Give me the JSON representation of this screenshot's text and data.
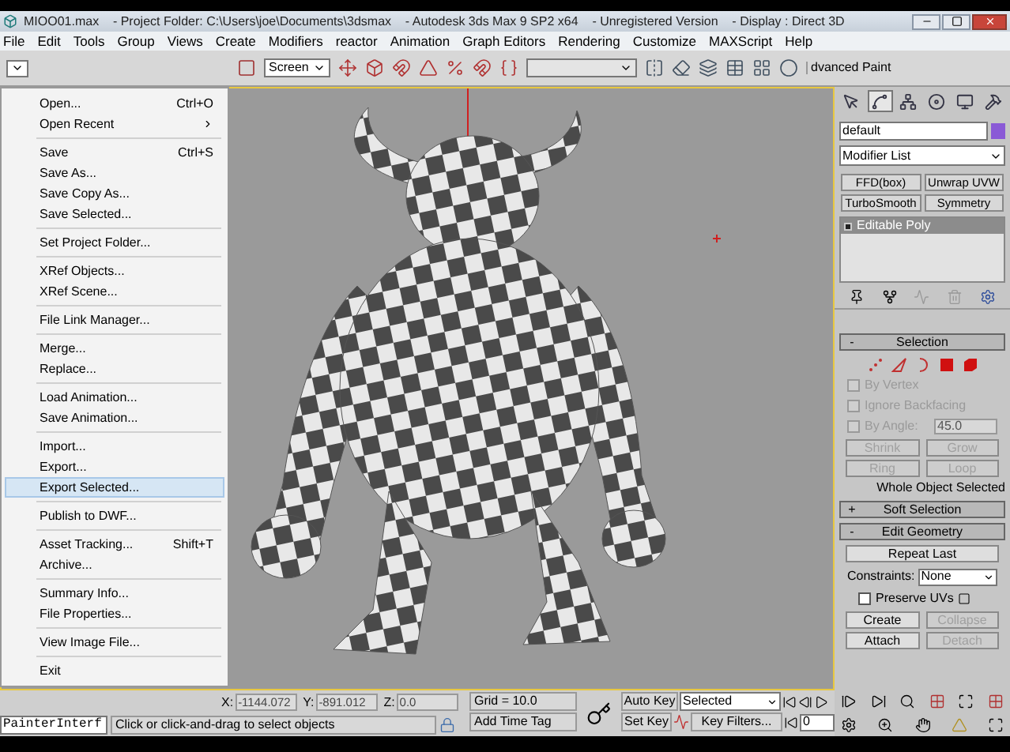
{
  "window": {
    "title": "MIOO01.max    - Project Folder: C:\\Users\\joe\\Documents\\3dsmax    - Autodesk 3ds Max 9 SP2 x64    - Unregistered Version    - Display : Direct 3D"
  },
  "menu_bar": [
    "File",
    "Edit",
    "Tools",
    "Group",
    "Views",
    "Create",
    "Modifiers",
    "reactor",
    "Animation",
    "Graph Editors",
    "Rendering",
    "Customize",
    "MAXScript",
    "Help"
  ],
  "toolbar": {
    "reference_coordinate_system": "Screen",
    "advanced_paint": "dvanced Paint"
  },
  "file_menu": {
    "groups": [
      [
        {
          "label": "Open...",
          "shortcut": "Ctrl+O",
          "submenu": false,
          "selected": false
        },
        {
          "label": "Open Recent",
          "submenu": true,
          "selected": false
        }
      ],
      [
        {
          "label": "Save",
          "shortcut": "Ctrl+S",
          "submenu": false,
          "selected": false
        },
        {
          "label": "Save As...",
          "submenu": false,
          "selected": false
        },
        {
          "label": "Save Copy As...",
          "submenu": false,
          "selected": false
        },
        {
          "label": "Save Selected...",
          "submenu": false,
          "selected": false
        }
      ],
      [
        {
          "label": "Set Project Folder...",
          "submenu": false,
          "selected": false
        }
      ],
      [
        {
          "label": "XRef Objects...",
          "submenu": false,
          "selected": false
        },
        {
          "label": "XRef Scene...",
          "submenu": false,
          "selected": false
        }
      ],
      [
        {
          "label": "File Link Manager...",
          "submenu": false,
          "selected": false
        }
      ],
      [
        {
          "label": "Merge...",
          "submenu": false,
          "selected": false
        },
        {
          "label": "Replace...",
          "submenu": false,
          "selected": false
        }
      ],
      [
        {
          "label": "Load Animation...",
          "submenu": false,
          "selected": false
        },
        {
          "label": "Save Animation...",
          "submenu": false,
          "selected": false
        }
      ],
      [
        {
          "label": "Import...",
          "submenu": false,
          "selected": false
        },
        {
          "label": "Export...",
          "submenu": false,
          "selected": false
        },
        {
          "label": "Export Selected...",
          "submenu": false,
          "selected": true
        }
      ],
      [
        {
          "label": "Publish to DWF...",
          "submenu": false,
          "selected": false
        }
      ],
      [
        {
          "label": "Asset Tracking...",
          "shortcut": "Shift+T",
          "submenu": false,
          "selected": false
        },
        {
          "label": "Archive...",
          "submenu": false,
          "selected": false
        }
      ],
      [
        {
          "label": "Summary Info...",
          "submenu": false,
          "selected": false
        },
        {
          "label": "File Properties...",
          "submenu": false,
          "selected": false
        }
      ],
      [
        {
          "label": "View Image File...",
          "submenu": false,
          "selected": false
        }
      ],
      [
        {
          "label": "Exit",
          "submenu": false,
          "selected": false
        }
      ]
    ]
  },
  "command_panel": {
    "tabs": [
      {
        "selected": false
      },
      {
        "selected": true
      },
      {
        "selected": false
      },
      {
        "selected": false
      },
      {
        "selected": false
      },
      {
        "selected": false
      }
    ],
    "object_name": "default",
    "modifier_list": "Modifier List",
    "modifier_buttons": [
      "FFD(box)",
      "Unwrap UVW",
      "TurboSmooth",
      "Symmetry"
    ],
    "stack": [
      {
        "label": "Editable Poly",
        "selected": true
      }
    ],
    "selection_rollout": {
      "toggle": "-",
      "title": "Selection",
      "checkboxes": [
        {
          "label": "By Vertex",
          "checked": false,
          "disabled": true
        },
        {
          "label": "Ignore Backfacing",
          "checked": false,
          "disabled": true
        },
        {
          "label": "By Angle:",
          "checked": false,
          "disabled": true,
          "value": "45.0"
        }
      ],
      "buttons": [
        {
          "label": "Shrink",
          "disabled": true
        },
        {
          "label": "Grow",
          "disabled": true
        },
        {
          "label": "Ring",
          "disabled": true
        },
        {
          "label": "Loop",
          "disabled": true
        }
      ],
      "status": "Whole Object Selected"
    },
    "soft_selection_rollout": {
      "toggle": "+",
      "title": "Soft Selection"
    },
    "edit_geometry_rollout": {
      "toggle": "-",
      "title": "Edit Geometry",
      "repeat_last": "Repeat Last",
      "constraints": {
        "label": "Constraints:",
        "value": "None"
      },
      "preserve_uvs": {
        "label": "Preserve UVs",
        "checked": false
      },
      "buttons": [
        {
          "label": "Create",
          "disabled": false
        },
        {
          "label": "Collapse",
          "disabled": true
        },
        {
          "label": "Attach",
          "disabled": false
        },
        {
          "label": "Detach",
          "disabled": true
        }
      ]
    }
  },
  "status_bar": {
    "script_listener": "PainterInterf",
    "prompt": "Click or click-and-drag to select objects",
    "coordinates": [
      {
        "axis": "X:",
        "value": "-1144.072"
      },
      {
        "axis": "Y:",
        "value": "-891.012"
      },
      {
        "axis": "Z:",
        "value": "0.0"
      }
    ],
    "grid": "Grid = 10.0",
    "time_tag": "Add Time Tag",
    "auto_key": "Auto Key",
    "key_set": "Selected",
    "set_key": "Set Key",
    "key_filters": "Key Filters...",
    "frame": "0"
  }
}
